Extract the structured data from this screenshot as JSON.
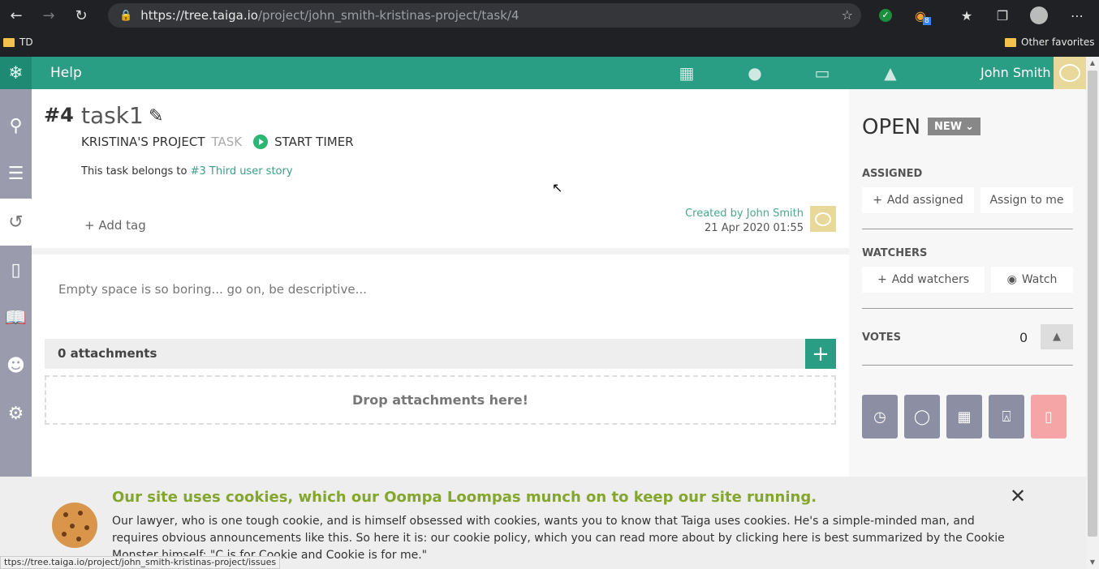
{
  "browser": {
    "url_host": "https://tree.taiga.io",
    "url_path": "/project/john_smith-kristinas-project/task/4",
    "ext_badge": "8"
  },
  "bookmarks": {
    "left_folder": "TD",
    "right_folder": "Other favorites"
  },
  "topnav": {
    "help": "Help",
    "username": "John Smith"
  },
  "task": {
    "ref": "#4",
    "subject": "task1",
    "project": "KRISTINA'S PROJECT",
    "type_label": "TASK",
    "timer_label": "START TIMER",
    "belongs_prefix": "This task belongs to",
    "belongs_link": "#3 Third user story",
    "add_tag": "Add tag",
    "created_by": "Created by John Smith",
    "created_date": "21 Apr 2020 01:55",
    "description_placeholder": "Empty space is so boring... go on, be descriptive..."
  },
  "attachments": {
    "label": "0 attachments",
    "dropzone": "Drop attachments here!"
  },
  "side_panel": {
    "status": "OPEN",
    "status_badge": "NEW",
    "assigned_title": "ASSIGNED",
    "add_assigned": "Add assigned",
    "assign_to_me": "Assign to me",
    "watchers_title": "WATCHERS",
    "add_watchers": "Add watchers",
    "watch": "Watch",
    "votes_title": "VOTES",
    "votes_count": "0"
  },
  "cookie_banner": {
    "title": "Our site uses cookies, which our Oompa Loompas munch on to keep our site running.",
    "text": "Our lawyer, who is one tough cookie, and is himself obsessed with cookies, wants you to know that Taiga uses cookies. He's a simple-minded man, and requires obvious announcements like this. So here it is: our cookie policy, which you can read more about by clicking here is best summarized by the Cookie Monster himself: \"C is for Cookie and Cookie is for me.\""
  },
  "status_bar_url": "ttps://tree.taiga.io/project/john_smith-kristinas-project/issues",
  "colors": {
    "brand": "#2a9d85",
    "sidebar": "#9a9cae",
    "cookie_title": "#84a62c"
  }
}
